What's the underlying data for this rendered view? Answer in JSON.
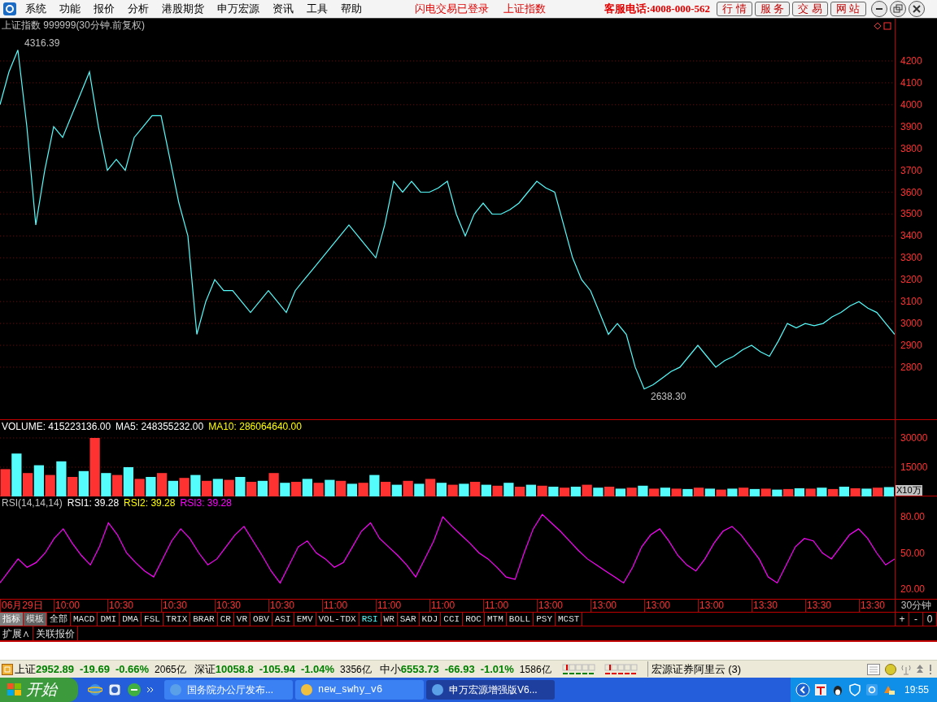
{
  "menu": [
    "系统",
    "功能",
    "报价",
    "分析",
    "港股期货",
    "申万宏源",
    "资讯",
    "工具",
    "帮助"
  ],
  "notices": [
    "闪电交易已登录",
    "上证指数"
  ],
  "hotline": "客服电话:4008-000-562",
  "top_buttons": [
    "行 情",
    "服 务",
    "交 易",
    "网 站"
  ],
  "chart_title": "上证指数 999999(30分钟.前复权)",
  "price_chart": {
    "chart_data": {
      "type": "line",
      "grid": true,
      "ylim": [
        2562,
        4330
      ],
      "yticks": [
        {
          "value": 2800,
          "label": "2800"
        },
        {
          "value": 2900,
          "label": "2900"
        },
        {
          "value": 3000,
          "label": "3000"
        },
        {
          "value": 3100,
          "label": "3100"
        },
        {
          "value": 3200,
          "label": "3200"
        },
        {
          "value": 3300,
          "label": "3300"
        },
        {
          "value": 3400,
          "label": "3400"
        },
        {
          "value": 3500,
          "label": "3500"
        },
        {
          "value": 3600,
          "label": "3600"
        },
        {
          "value": 3700,
          "label": "3700"
        },
        {
          "value": 3800,
          "label": "3800"
        },
        {
          "value": 3900,
          "label": "3900"
        },
        {
          "value": 4000,
          "label": "4000"
        },
        {
          "value": 4100,
          "label": "4100"
        },
        {
          "value": 4200,
          "label": "4200"
        }
      ],
      "series": [
        {
          "color": "#54fcfc",
          "values": [
            4000,
            4150,
            4250,
            3900,
            3450,
            3700,
            3900,
            3850,
            3950,
            4050,
            4150,
            3900,
            3700,
            3750,
            3700,
            3850,
            3900,
            3950,
            3950,
            3750,
            3550,
            3400,
            2950,
            3100,
            3200,
            3150,
            3150,
            3100,
            3050,
            3100,
            3150,
            3100,
            3050,
            3150,
            3200,
            3250,
            3300,
            3350,
            3400,
            3450,
            3400,
            3350,
            3300,
            3450,
            3650,
            3600,
            3650,
            3600,
            3600,
            3620,
            3650,
            3500,
            3400,
            3500,
            3550,
            3500,
            3500,
            3520,
            3550,
            3600,
            3650,
            3620,
            3600,
            3450,
            3300,
            3200,
            3150,
            3050,
            2950,
            3000,
            2950,
            2800,
            2700,
            2720,
            2750,
            2780,
            2800,
            2850,
            2900,
            2850,
            2800,
            2830,
            2850,
            2880,
            2900,
            2870,
            2850,
            2920,
            3000,
            2980,
            3000,
            2990,
            3000,
            3030,
            3050,
            3080,
            3100,
            3070,
            3050,
            3000,
            2950
          ]
        }
      ],
      "annotations": [
        "4316.39",
        "2638.30"
      ]
    }
  },
  "volume": {
    "legend": [
      {
        "text": "VOLUME: 415223136.00",
        "color": "#ffffff"
      },
      {
        "text": "MA5: 248355232.00",
        "color": "#ffffff"
      },
      {
        "text": "MA10: 286064640.00",
        "color": "#ffff00"
      }
    ],
    "unit": "X10万",
    "chart_data": {
      "type": "bar",
      "grid": true,
      "ylim": [
        0,
        39167
      ],
      "yticks": [
        {
          "value": 15000,
          "label": "15000"
        },
        {
          "value": 30000,
          "label": "30000"
        }
      ],
      "series": [
        {
          "color": "#ff3232",
          "values": [
            14000,
            null,
            12000,
            null,
            11000,
            null,
            10000,
            null,
            30000,
            null,
            11000,
            null,
            9000,
            null,
            12000,
            null,
            9500,
            null,
            8000,
            null,
            8500,
            null,
            7500,
            null,
            12000,
            null,
            7500,
            null,
            7000,
            null,
            8000,
            null,
            7000,
            null,
            7500,
            null,
            8000,
            null,
            9000,
            null,
            6000,
            null,
            7500,
            null,
            5500,
            null,
            5000,
            null,
            5500,
            null,
            4500,
            null,
            6000,
            null,
            5000,
            null,
            4500,
            null,
            4000,
            null,
            4000,
            null,
            4500,
            null,
            3500,
            null,
            4500,
            null,
            4000,
            null,
            3800,
            null,
            4000,
            null,
            3800,
            null,
            4200,
            null,
            4500,
            null
          ]
        },
        {
          "color": "#54fcfc",
          "values": [
            null,
            22000,
            null,
            16000,
            null,
            18000,
            null,
            13000,
            null,
            12000,
            null,
            15000,
            null,
            10000,
            null,
            8000,
            null,
            11000,
            null,
            9000,
            null,
            10000,
            null,
            8000,
            null,
            7000,
            null,
            9000,
            null,
            8500,
            null,
            6500,
            null,
            11000,
            null,
            6000,
            null,
            6500,
            null,
            7000,
            null,
            6500,
            null,
            6000,
            null,
            7000,
            null,
            6000,
            null,
            5000,
            null,
            5000,
            null,
            4500,
            null,
            4000,
            null,
            5500,
            null,
            4500,
            null,
            3800,
            null,
            4000,
            null,
            4000,
            null,
            3800,
            null,
            3500,
            null,
            4200,
            null,
            4500,
            null,
            5000,
            null,
            4000,
            null,
            4800
          ]
        }
      ]
    }
  },
  "rsi": {
    "legend": [
      {
        "text": "RSI(14,14,14)",
        "color": "#c0c0c0"
      },
      {
        "text": "RSI1: 39.28",
        "color": "#ffffff"
      },
      {
        "text": "RSI2: 39.28",
        "color": "#ffff00"
      },
      {
        "text": "RSI3: 39.28",
        "color": "#ff00ff"
      }
    ],
    "chart_data": {
      "type": "line",
      "ylim": [
        11.2,
        96.9
      ],
      "yticks": [
        {
          "value": 20,
          "label": "20.00"
        },
        {
          "value": 50,
          "label": "50.00"
        },
        {
          "value": 80,
          "label": "80.00"
        }
      ],
      "series": [
        {
          "color": "#ff00ff",
          "values": [
            25,
            35,
            45,
            38,
            42,
            50,
            62,
            70,
            58,
            48,
            40,
            55,
            75,
            65,
            50,
            42,
            35,
            30,
            45,
            60,
            70,
            62,
            50,
            40,
            45,
            55,
            65,
            72,
            60,
            48,
            35,
            25,
            40,
            55,
            60,
            50,
            45,
            38,
            42,
            55,
            68,
            75,
            62,
            55,
            48,
            40,
            30,
            45,
            60,
            80,
            72,
            65,
            58,
            50,
            45,
            38,
            30,
            28,
            50,
            70,
            82,
            75,
            68,
            60,
            52,
            45,
            40,
            35,
            30,
            25,
            38,
            55,
            65,
            70,
            60,
            48,
            40,
            35,
            45,
            58,
            68,
            72,
            65,
            55,
            45,
            30,
            25,
            40,
            55,
            62,
            60,
            50,
            45,
            55,
            65,
            70,
            62,
            50,
            40,
            45
          ]
        }
      ]
    }
  },
  "time_axis": [
    "06月29日",
    "10:00",
    "10:30",
    "10:30",
    "10:30",
    "10:30",
    "11:00",
    "11:00",
    "11:00",
    "11:00",
    "13:00",
    "13:00",
    "13:00",
    "13:00",
    "13:30",
    "13:30",
    "13:30"
  ],
  "period": "30分钟",
  "indicator_tabs": [
    {
      "label": "指标",
      "kind": "mode",
      "selected": true
    },
    {
      "label": "模板",
      "kind": "mode",
      "selected": false
    },
    {
      "label": "全部",
      "kind": "indicator",
      "selected": false
    },
    {
      "label": "MACD",
      "kind": "indicator",
      "selected": false
    },
    {
      "label": "DMI",
      "kind": "indicator",
      "selected": false
    },
    {
      "label": "DMA",
      "kind": "indicator",
      "selected": false
    },
    {
      "label": "FSL",
      "kind": "indicator",
      "selected": false
    },
    {
      "label": "TRIX",
      "kind": "indicator",
      "selected": false
    },
    {
      "label": "BRAR",
      "kind": "indicator",
      "selected": false
    },
    {
      "label": "CR",
      "kind": "indicator",
      "selected": false
    },
    {
      "label": "VR",
      "kind": "indicator",
      "selected": false
    },
    {
      "label": "OBV",
      "kind": "indicator",
      "selected": false
    },
    {
      "label": "ASI",
      "kind": "indicator",
      "selected": false
    },
    {
      "label": "EMV",
      "kind": "indicator",
      "selected": false
    },
    {
      "label": "VOL-TDX",
      "kind": "indicator",
      "selected": false
    },
    {
      "label": "RSI",
      "kind": "indicator",
      "selected": true
    },
    {
      "label": "WR",
      "kind": "indicator",
      "selected": false
    },
    {
      "label": "SAR",
      "kind": "indicator",
      "selected": false
    },
    {
      "label": "KDJ",
      "kind": "indicator",
      "selected": false
    },
    {
      "label": "CCI",
      "kind": "indicator",
      "selected": false
    },
    {
      "label": "ROC",
      "kind": "indicator",
      "selected": false
    },
    {
      "label": "MTM",
      "kind": "indicator",
      "selected": false
    },
    {
      "label": "BOLL",
      "kind": "indicator",
      "selected": false
    },
    {
      "label": "PSY",
      "kind": "indicator",
      "selected": false
    },
    {
      "label": "MCST",
      "kind": "indicator",
      "selected": false
    }
  ],
  "zoom_buttons": [
    "+",
    "-",
    "0"
  ],
  "extra_tabs": [
    "扩展∧",
    "关联报价"
  ],
  "indices": [
    {
      "name": "上证",
      "value": "2952.89",
      "change": "-19.69",
      "pct": "-0.66%",
      "amount": "2065亿"
    },
    {
      "name": "深证",
      "value": "10058.8",
      "change": "-105.94",
      "pct": "-1.04%",
      "amount": "3356亿"
    },
    {
      "name": "中小",
      "value": "6553.73",
      "change": "-66.93",
      "pct": "-1.01%",
      "amount": "1586亿"
    }
  ],
  "server": "宏源证券阿里云 (3)",
  "taskbar": {
    "start": "开始",
    "tasks": [
      {
        "label": "国务院办公厅发布...",
        "selected": false
      },
      {
        "label": "new_swhy_v6",
        "selected": false
      },
      {
        "label": "申万宏源增强版V6...",
        "selected": true
      }
    ],
    "clock": "19:55"
  }
}
